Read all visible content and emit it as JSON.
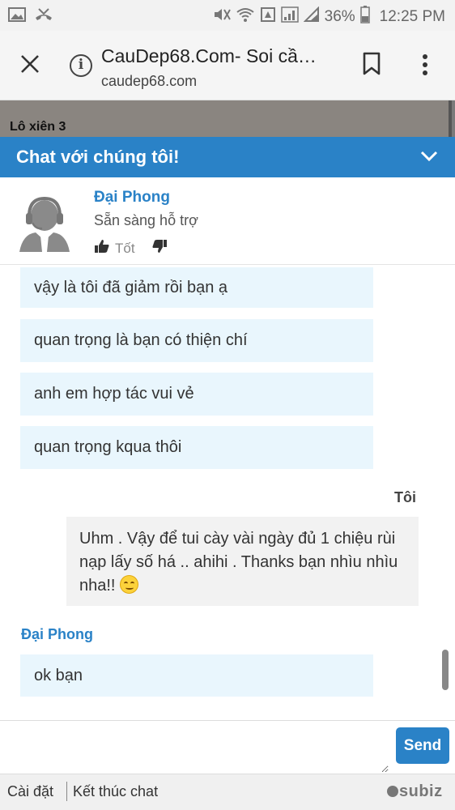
{
  "status_bar": {
    "battery": "36%",
    "time": "12:25 PM"
  },
  "browser": {
    "title": "CauDep68.Com- Soi cầ…",
    "url": "caudep68.com"
  },
  "page_behind": {
    "text": "Lô xiên 3"
  },
  "chat": {
    "header_title": "Chat với chúng tôi!",
    "agent": {
      "name": "Đại Phong",
      "status": "Sẵn sàng hỗ trợ",
      "rate_good_label": "Tốt"
    },
    "messages_top": [
      "vậy là tôi đã giảm rồi bạn ạ",
      "quan trọng là bạn có thiện chí",
      "anh em hợp tác vui vẻ",
      "quan trọng kqua thôi"
    ],
    "me_label": "Tôi",
    "my_message": "Uhm . Vậy để tui cày vài ngày đủ 1 chiệu rùi nạp lấy số há .. ahihi . Thanks bạn nhìu nhìu nha!!",
    "agent_label": "Đại Phong",
    "agent_last_message": "ok bạn",
    "input_value": "",
    "send_label": "Send"
  },
  "footer": {
    "settings_label": "Cài đặt",
    "end_chat_label": "Kết thúc chat",
    "brand": "subiz"
  },
  "colors": {
    "accent": "#2a82c7",
    "bubble_agent": "#e9f6fd",
    "bubble_me": "#f2f2f2"
  }
}
